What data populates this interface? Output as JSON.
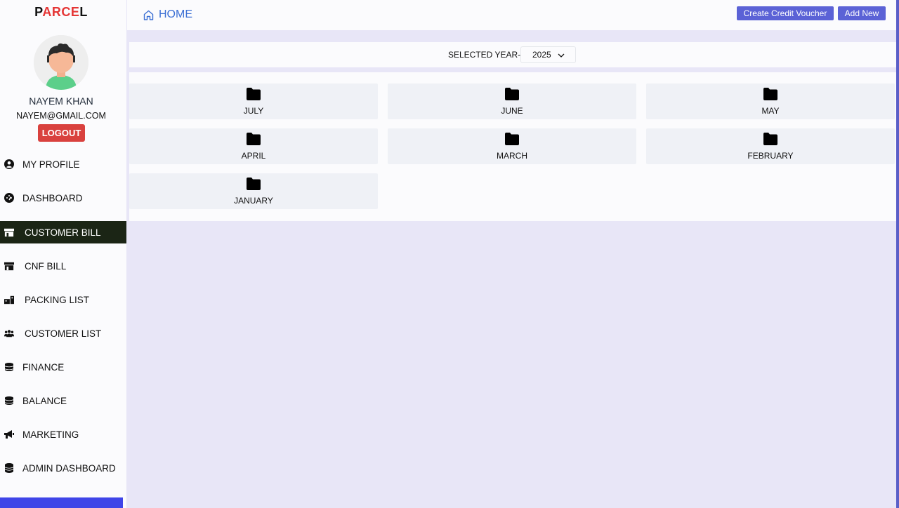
{
  "brand": {
    "logo_part1": "P",
    "logo_part2": "ARCE",
    "logo_part3": "L"
  },
  "user": {
    "name": "NAYEM KHAN",
    "email": "NAYEM@GMAIL.COM",
    "logout_label": "LOGOUT"
  },
  "sidebar": {
    "items": [
      {
        "label": "MY PROFILE",
        "icon": "user-circle-icon"
      },
      {
        "label": "DASHBOARD",
        "icon": "gauge-icon"
      },
      {
        "label": "CUSTOMER BILL",
        "icon": "store-icon",
        "active": true
      },
      {
        "label": "CNF BILL",
        "icon": "store-icon"
      },
      {
        "label": "PACKING LIST",
        "icon": "boxes-icon"
      },
      {
        "label": "CUSTOMER LIST",
        "icon": "users-icon"
      },
      {
        "label": "FINANCE",
        "icon": "coins-icon"
      },
      {
        "label": "BALANCE",
        "icon": "coins-icon"
      },
      {
        "label": "MARKETING",
        "icon": "megaphone-icon"
      },
      {
        "label": "ADMIN DASHBOARD",
        "icon": "database-icon"
      }
    ]
  },
  "header": {
    "home_label": "HOME",
    "create_credit_label": "Create Credit Voucher",
    "add_new_label": "Add New"
  },
  "year_selector": {
    "label": "SELECTED YEAR-",
    "value": "2025"
  },
  "folders": [
    "JULY",
    "JUNE",
    "MAY",
    "APRIL",
    "MARCH",
    "FEBRUARY",
    "JANUARY"
  ],
  "colors": {
    "accent": "#5b62d6",
    "active_nav": "#1b2515",
    "logout": "#d9413e",
    "home": "#3b6fd4"
  }
}
